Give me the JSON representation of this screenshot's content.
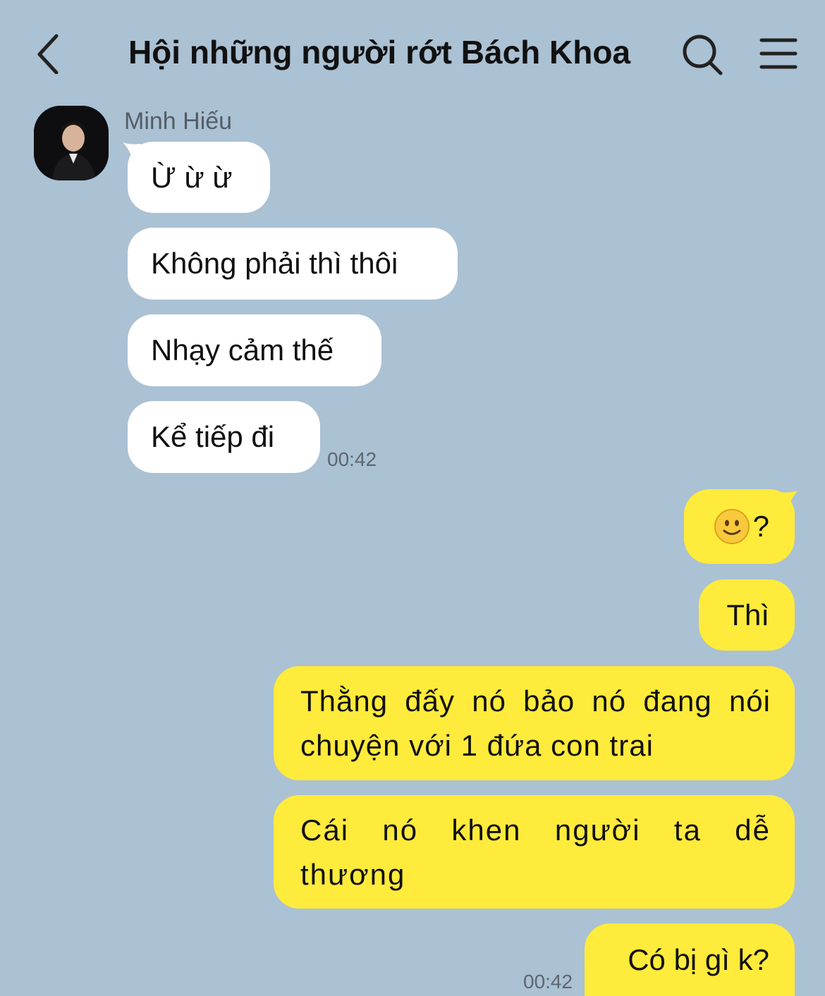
{
  "header": {
    "title": "Hội những người rớt Bách Khoa",
    "back_icon": "chevron-left-icon",
    "search_icon": "search-icon",
    "menu_icon": "hamburger-menu-icon"
  },
  "incoming": {
    "sender": "Minh Hiếu",
    "messages": [
      "Ừ ừ ừ",
      "Không phải thì thôi",
      "Nhạy cảm thế",
      "Kể tiếp đi"
    ],
    "time": "00:42"
  },
  "outgoing": {
    "emoji_message": {
      "emoji": "slightly-smiling-face-icon",
      "text": "?"
    },
    "messages": [
      "Thì",
      "Thằng đấy nó bảo nó đang nói chuyện với 1 đứa con trai",
      "Cái nó khen người ta dễ thương",
      "Có bị gì k?"
    ],
    "time": "00:42"
  },
  "colors": {
    "background": "#abc1d4",
    "incoming_bubble": "#ffffff",
    "outgoing_bubble": "#ffeb3b"
  }
}
